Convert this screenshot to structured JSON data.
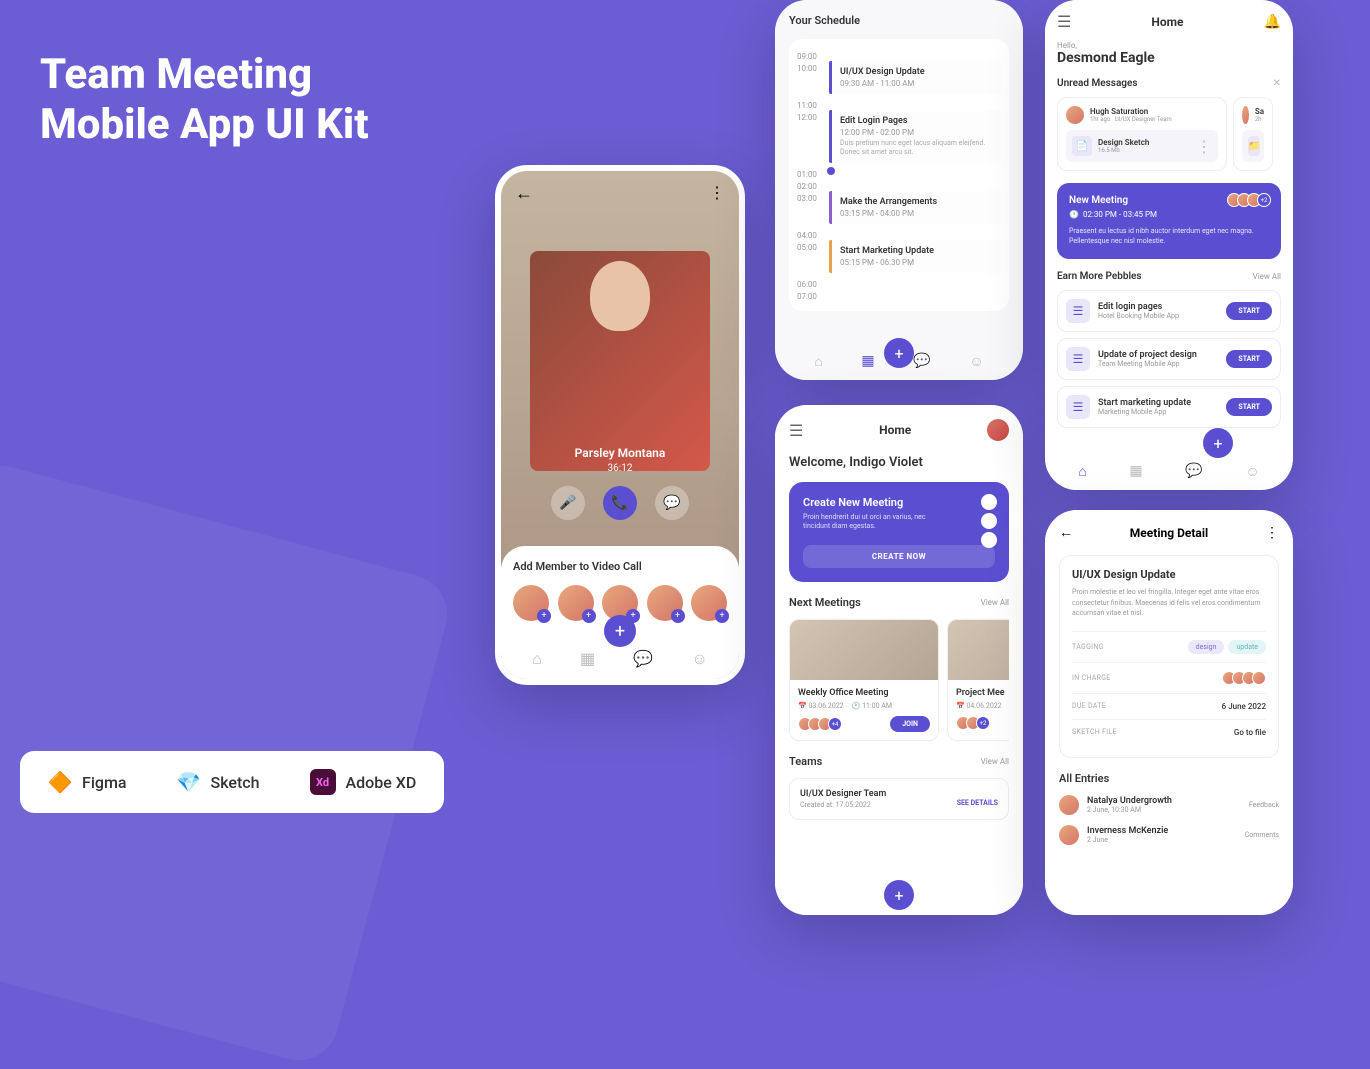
{
  "hero": {
    "title_line1": "Team Meeting",
    "title_line2": "Mobile App UI Kit"
  },
  "tools": {
    "figma": "Figma",
    "sketch": "Sketch",
    "xd": "Adobe XD"
  },
  "videoCall": {
    "name": "Parsley Montana",
    "duration": "36:12",
    "addTitle": "Add Member to Video Call"
  },
  "schedule": {
    "title": "Your Schedule",
    "times": [
      "09:00",
      "10:00",
      "11:00",
      "12:00",
      "01:00",
      "02:00",
      "03:00",
      "04:00",
      "05:00",
      "06:00",
      "07:00"
    ],
    "events": [
      {
        "title": "UI/UX Design Update",
        "time": "09:30 AM - 11:00 AM",
        "color": "#5b4fd1"
      },
      {
        "title": "Edit Login Pages",
        "time": "12:00 PM - 02:00 PM",
        "desc": "Duis pretium nunc eget lacus aliquam eleifend. Donec sit amet arcu sit.",
        "color": "#5b4fd1"
      },
      {
        "title": "Make the Arrangements",
        "time": "03:15 PM - 04:00 PM",
        "color": "#8a5fd1"
      },
      {
        "title": "Start Marketing Update",
        "time": "05:15 PM - 06:30 PM",
        "color": "#e8a04a"
      }
    ]
  },
  "home": {
    "title": "Home",
    "welcome": "Welcome, Indigo Violet",
    "create": {
      "title": "Create New Meeting",
      "desc": "Proin hendrerit dui ut orci an varius, nec tincidunt diam egestas.",
      "btn": "CREATE NOW"
    },
    "nextMeetings": {
      "title": "Next Meetings",
      "link": "View All"
    },
    "meetings": [
      {
        "title": "Weekly Office Meeting",
        "date": "03.06.2022",
        "time": "11:00 AM",
        "more": "+4",
        "join": "JOIN"
      },
      {
        "title": "Project Mee",
        "date": "04.06.2022",
        "more": "+2"
      }
    ],
    "teams": {
      "title": "Teams",
      "link": "View All"
    },
    "team": {
      "title": "UI/UX Designer Team",
      "created": "Created at: 17.05.2022",
      "details": "SEE DETAILS"
    }
  },
  "eagle": {
    "title": "Home",
    "hello": "Hello,",
    "name": "Desmond Eagle",
    "unread": {
      "title": "Unread Messages"
    },
    "msgs": [
      {
        "name": "Hugh Saturation",
        "meta": "1hr ago",
        "meta2": "UI/UX Designer Team",
        "file": "Design Sketch",
        "size": "16.5 Mb"
      },
      {
        "name": "Sa",
        "meta": "2h"
      }
    ],
    "newMeeting": {
      "title": "New Meeting",
      "time": "02:30 PM - 03:45 PM",
      "desc": "Praesent eu lectus id nibh auctor interdum eget nec magna. Pellentesque nec nisl molestie.",
      "more": "+2"
    },
    "pebbles": {
      "title": "Earn More Pebbles",
      "link": "View All"
    },
    "tasks": [
      {
        "title": "Edit login pages",
        "sub": "Hotel Booking Mobile App",
        "btn": "START"
      },
      {
        "title": "Update of project design",
        "sub": "Team Meeting Mobile App",
        "btn": "START"
      },
      {
        "title": "Start marketing update",
        "sub": "Marketing Mobile App",
        "btn": "START"
      }
    ]
  },
  "detail": {
    "title": "Meeting Detail",
    "name": "UI/UX Design Update",
    "desc": "Proin molestie et leo vel fringilla. Integer eget ante vitae eros consectetur finibus. Maecenas id felis vel eros condimentum accumsan vitae et nisl.",
    "tagging": "TAGGING",
    "tags": [
      "design",
      "update"
    ],
    "inCharge": "IN CHARGE",
    "dueDate": "DUE DATE",
    "dueDateVal": "6 June 2022",
    "sketchFile": "SKETCH FILE",
    "sketchVal": "Go to file",
    "entries": "All Entries",
    "entryList": [
      {
        "name": "Natalya Undergrowth",
        "meta": "2 June, 10:30 AM",
        "type": "Feedback"
      },
      {
        "name": "Inverness McKenzie",
        "meta": "2 June",
        "type": "Comments"
      }
    ]
  }
}
